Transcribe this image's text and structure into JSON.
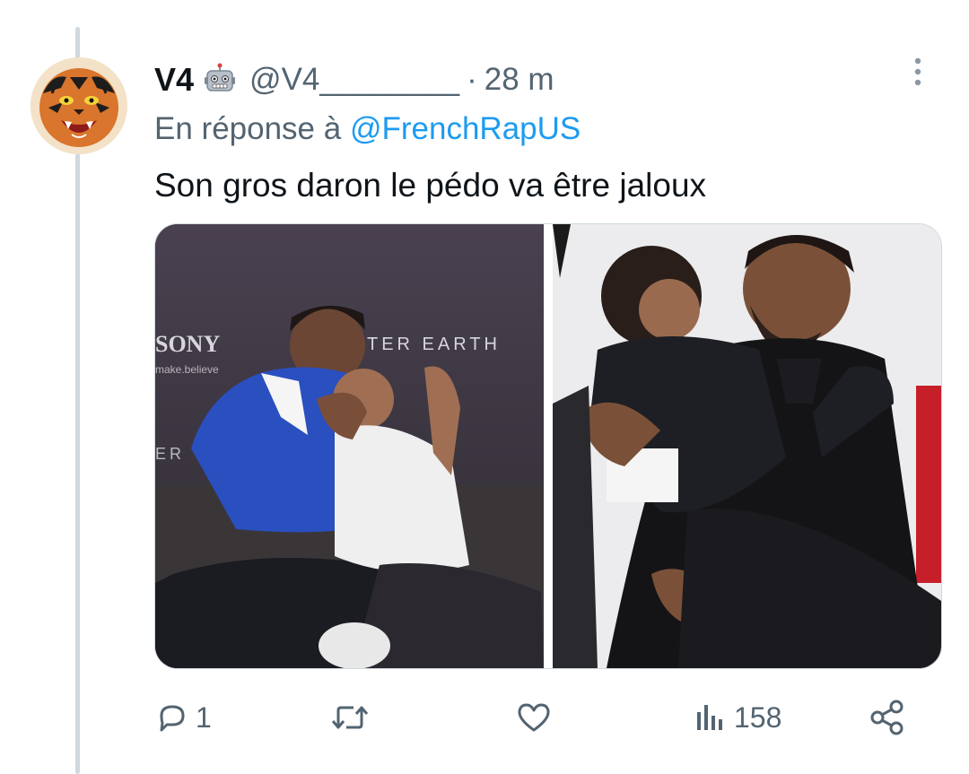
{
  "tweet": {
    "display_name": "V4",
    "bot_icon": "robot-icon",
    "handle": "@V4________",
    "separator": "·",
    "time": "28 m",
    "reply_prefix": "En réponse à",
    "reply_to": "@FrenchRapUS",
    "text": "Son gros daron le pédo va être jaloux",
    "media": [
      {
        "icon": "photo-icon",
        "overlay_text_1": "SONY",
        "overlay_text_2": "make.believe",
        "overlay_text_3": "TER EARTH",
        "overlay_text_4": "ER"
      },
      {
        "icon": "photo-icon"
      }
    ]
  },
  "actions": {
    "reply": {
      "icon": "reply-icon",
      "count": "1"
    },
    "retweet": {
      "icon": "retweet-icon",
      "count": ""
    },
    "like": {
      "icon": "heart-icon",
      "count": ""
    },
    "views": {
      "icon": "views-icon",
      "count": "158"
    },
    "share": {
      "icon": "share-icon"
    }
  },
  "colors": {
    "link": "#1d9bf0",
    "text": "#0f1419",
    "secondary": "#536471",
    "thread_line": "#cfd9de"
  }
}
